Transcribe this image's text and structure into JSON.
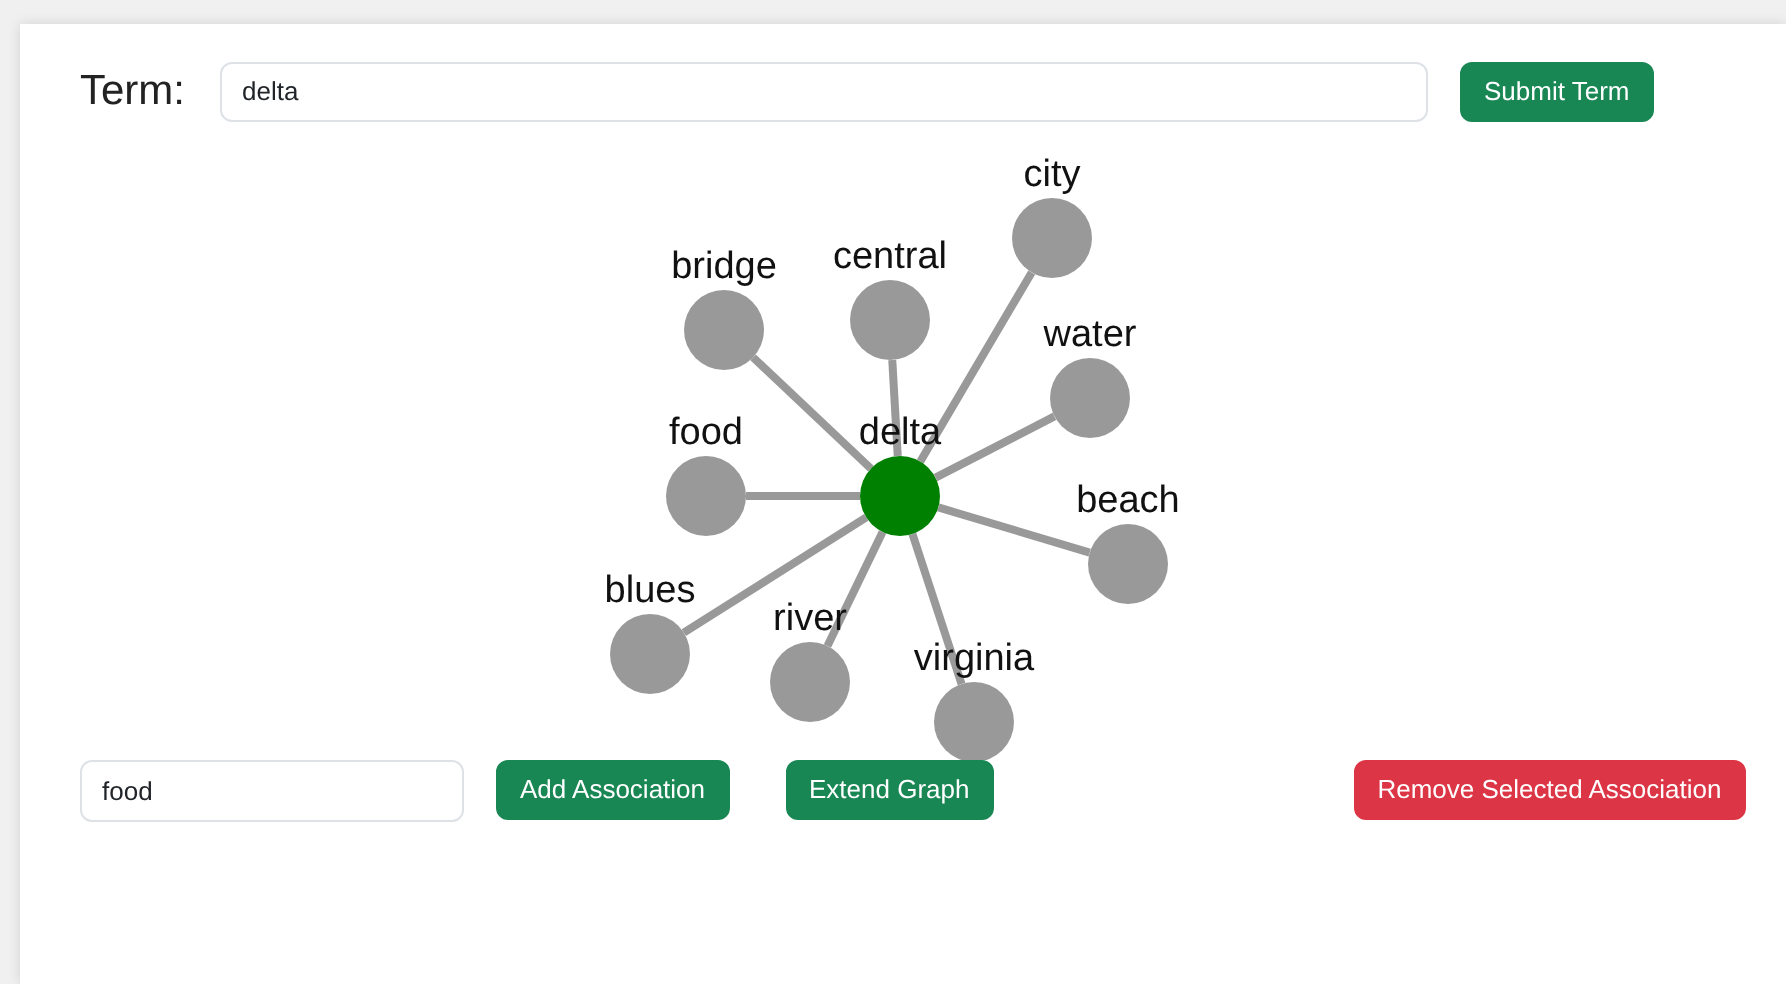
{
  "term": {
    "label": "Term:",
    "value": "delta",
    "button": "Submit Term"
  },
  "graph": {
    "nodes": [
      {
        "label": "delta",
        "kind": "center"
      },
      {
        "label": "city",
        "kind": "leaf"
      },
      {
        "label": "bridge",
        "kind": "leaf"
      },
      {
        "label": "central",
        "kind": "leaf"
      },
      {
        "label": "water",
        "kind": "leaf"
      },
      {
        "label": "food",
        "kind": "leaf"
      },
      {
        "label": "beach",
        "kind": "leaf"
      },
      {
        "label": "blues",
        "kind": "leaf"
      },
      {
        "label": "river",
        "kind": "leaf"
      },
      {
        "label": "virginia",
        "kind": "leaf"
      }
    ]
  },
  "association": {
    "value": "food",
    "buttons": [
      {
        "label": "Add Association",
        "kind": "primary"
      },
      {
        "label": "Extend Graph",
        "kind": "primary"
      },
      {
        "label": "Remove Selected Association",
        "kind": "danger"
      }
    ]
  }
}
